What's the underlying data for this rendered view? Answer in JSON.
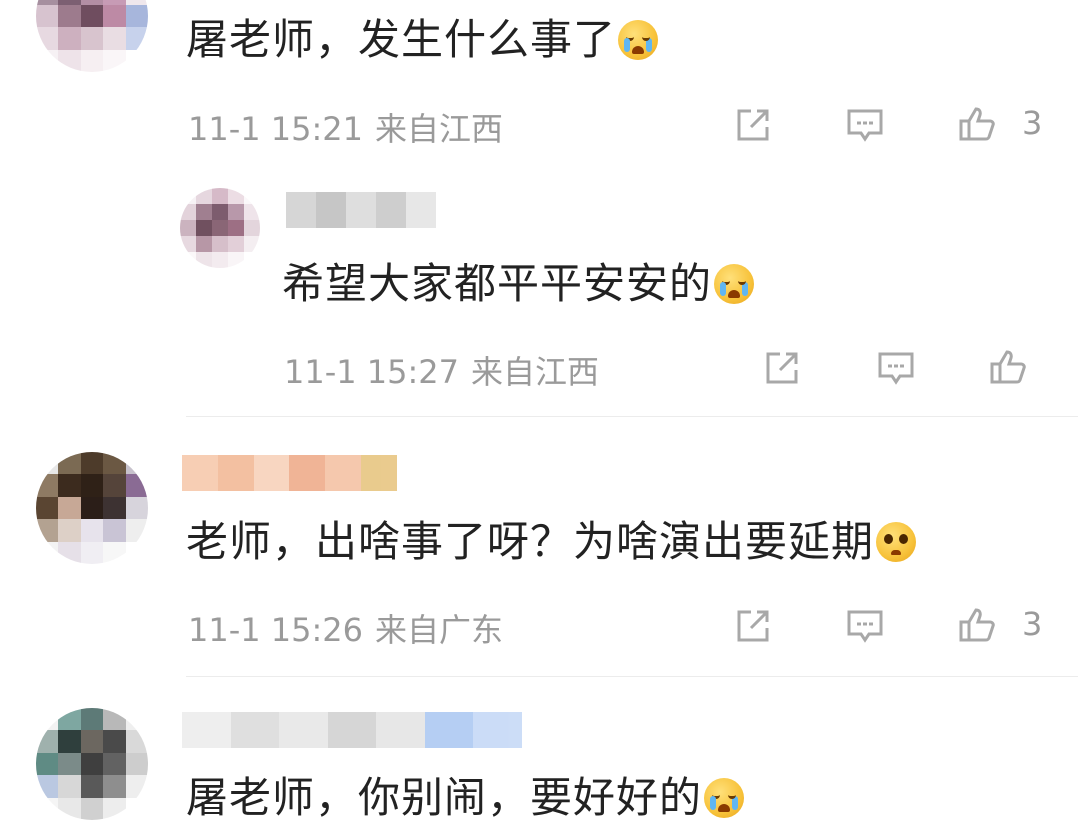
{
  "comments": [
    {
      "text": "屠老师，发生什么事了",
      "emoji": "loudly-crying-face",
      "time": "11-1 15:21",
      "location": "来自江西",
      "likes": "3"
    },
    {
      "text": "希望大家都平平安安的",
      "emoji": "loudly-crying-face",
      "time": "11-1 15:27",
      "location": "来自江西",
      "likes": ""
    },
    {
      "text": "老师，出啥事了呀？为啥演出要延期",
      "emoji": "pleading-face",
      "time": "11-1 15:26",
      "location": "来自广东",
      "likes": "3"
    },
    {
      "text": "屠老师，你别闹，要好好的",
      "emoji": "loudly-crying-face"
    }
  ],
  "colors": {
    "meta_gray": "#9a9a9a",
    "text": "#222222",
    "divider": "#ececec",
    "icon_gray": "#a8a8a8"
  }
}
